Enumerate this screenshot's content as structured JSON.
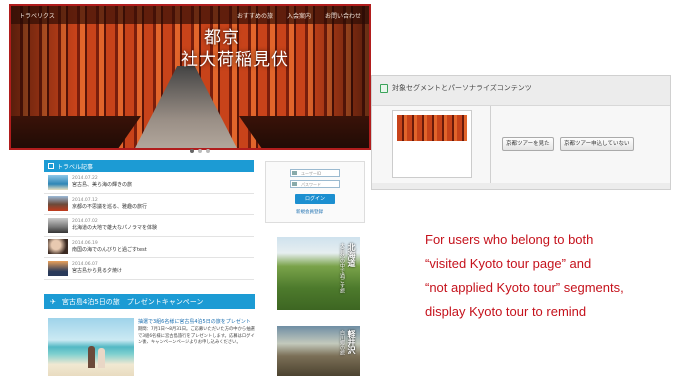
{
  "site": {
    "logo": "トラベリクス",
    "nav": [
      "おすすめの旅",
      "入会案内",
      "お問い合わせ"
    ],
    "hero_title_lines": [
      "京都",
      "伏見稲荷大社"
    ],
    "news": {
      "heading": "トラベル記事",
      "items": [
        {
          "date": "2014.07.22",
          "text": "宮古島、美ら海の輝きの旅"
        },
        {
          "date": "2014.07.12",
          "text": "京都の不思議を巡る、雅趣の旅行"
        },
        {
          "date": "2014.07.02",
          "text": "北海道の大地で雄大なパノラマを体験"
        },
        {
          "date": "2014.06.19",
          "text": "南国の海でのんびりと過ごすtest"
        },
        {
          "date": "2014.06.07",
          "text": "宮古島から見る夕焼け"
        }
      ]
    },
    "login": {
      "user_placeholder": "ユーザーID",
      "pass_placeholder": "パスワード",
      "button": "ログイン",
      "new_link": "新規会員登録"
    },
    "campaign": {
      "heading": "宮古島4泊5日の旅　プレゼントキャンペーン",
      "title": "抽選で3組6名様に宮古島4泊5日の旅をプレゼント",
      "body": "期間：7月1日〜8月31日。ご応募いただいた方の中から抽選で3組6名様に宮古島旅行をプレゼントします。応募はログイン後、キャンペーンページよりお申し込みください。"
    },
    "banners": [
      {
        "title": "北海道",
        "sub": "大自然の中で過ごす旅"
      },
      {
        "title": "軽井沢",
        "sub": "白川郷の旅"
      }
    ]
  },
  "panel": {
    "title": "対象セグメントとパーソナライズコンテンツ",
    "buttons": [
      "京都ツアーを見た",
      "京都ツアー申込していない"
    ]
  },
  "caption": {
    "lines": [
      "For users who belong to both",
      "“visited Kyoto tour page” and",
      "“not applied Kyoto tour” segments,",
      "display Kyoto tour to remind"
    ]
  },
  "colors": {
    "accent": "#1c9bd4",
    "highlight": "#b11d1d",
    "caption": "#c5121c"
  }
}
